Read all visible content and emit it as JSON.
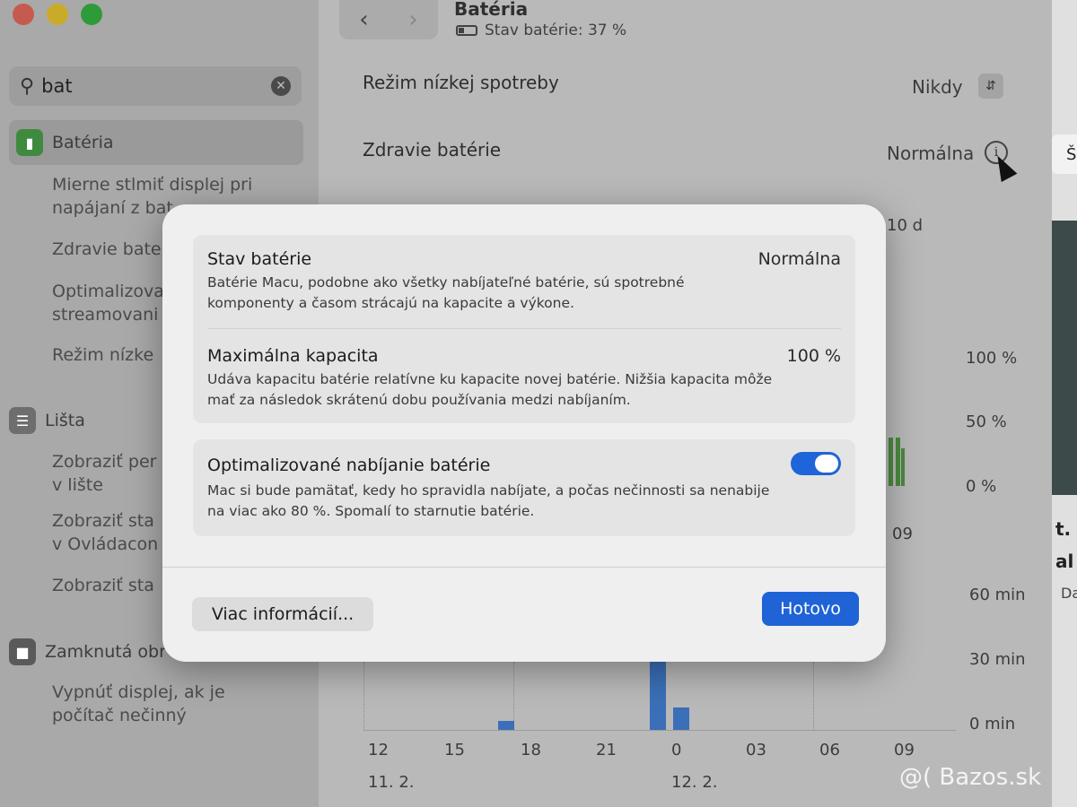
{
  "sidebar": {
    "search": {
      "value": "bat"
    },
    "items": [
      {
        "label": "Batéria",
        "icon": "battery-icon"
      },
      {
        "label": "Lišta",
        "icon": "menu-bar-icon"
      },
      {
        "label": "Zamknutá obr",
        "icon": "lock-icon"
      }
    ],
    "subitems": [
      "Mierne stlmiť displej pri napájaní z bat",
      "Zdravie bate",
      "Optimalizova streamovani",
      "Režim nízke",
      "Zobraziť per v lište",
      "Zobraziť sta v Ovládacon",
      "Zobraziť sta",
      "Vypnúť displej, ak je počítač nečinný"
    ]
  },
  "header": {
    "title": "Batéria",
    "subtitle": "Stav batérie: 37 %"
  },
  "main": {
    "low_power_label": "Režim nízkej spotreby",
    "low_power_value": "Nikdy",
    "health_label": "Zdravie batérie",
    "health_value": "Normálna",
    "tab_partial": "10 d",
    "chart_top_y": [
      "100 %",
      "50 %",
      "0 %"
    ],
    "chart_top_x_partial": "09",
    "chart_bottom_y": [
      "60 min",
      "30 min",
      "0 min"
    ],
    "chart_bottom_x": [
      "12",
      "15",
      "18",
      "21",
      "0",
      "03",
      "06",
      "09"
    ],
    "dates": [
      "11. 2.",
      "12. 2."
    ]
  },
  "chart_data": {
    "type": "bar",
    "ylabel": "",
    "y_ticks": [
      "60 min",
      "30 min",
      "0 min"
    ],
    "categories": [
      "12",
      "15",
      "18",
      "21",
      "0",
      "03",
      "06",
      "09"
    ],
    "dates": [
      "11. 2.",
      "12. 2."
    ],
    "series": [
      {
        "values": [
          0,
          0,
          4,
          0,
          0,
          0,
          0,
          0
        ]
      },
      {
        "values": [
          0,
          0,
          0,
          38,
          0,
          0,
          0,
          0
        ]
      },
      {
        "values": [
          0,
          0,
          0,
          10,
          0,
          0,
          0,
          0
        ]
      }
    ],
    "ylim": [
      0,
      60
    ]
  },
  "modal": {
    "rows": [
      {
        "title": "Stav batérie",
        "value": "Normálna",
        "desc": "Batérie Macu, podobne ako všetky nabíjateľné batérie, sú spotrebné komponenty a časom strácajú na kapacite a výkone."
      },
      {
        "title": "Maximálna kapacita",
        "value": "100 %",
        "desc": "Udáva kapacitu batérie relatívne ku kapacite novej batérie. Nižšia kapacita môže mať za následok skrátenú dobu používania medzi nabíjaním."
      },
      {
        "title": "Optimalizované nabíjanie batérie",
        "toggle": true,
        "desc": "Mac si bude pamätať, kedy ho spravidla nabíjate, a počas nečinnosti sa nenabije na viac ako 80 %. Spomalí to starnutie batérie."
      }
    ],
    "more_button": "Viac informácií...",
    "done_button": "Hotovo"
  },
  "right_panel": {
    "partial_texts": [
      "Š",
      "t.",
      "al",
      "Da"
    ]
  },
  "watermark": "@( Bazos.sk",
  "colors": {
    "accent": "#1f63d6",
    "toggle_on": "#1f64d8",
    "battery_green": "#3f8a3f"
  }
}
